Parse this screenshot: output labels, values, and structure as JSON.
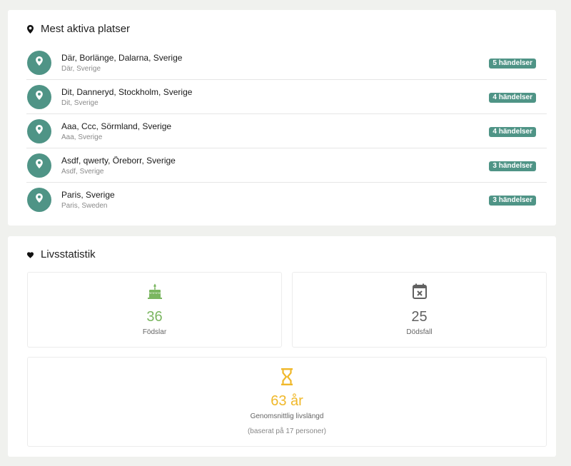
{
  "places": {
    "title": "Mest aktiva platser",
    "items": [
      {
        "name": "Där, Borlänge, Dalarna, Sverige",
        "sub": "Där, Sverige",
        "badge": "5 händelser"
      },
      {
        "name": "Dit, Danneryd, Stockholm, Sverige",
        "sub": "Dit, Sverige",
        "badge": "4 händelser"
      },
      {
        "name": "Aaa, Ccc, Sörmland, Sverige",
        "sub": "Aaa, Sverige",
        "badge": "4 händelser"
      },
      {
        "name": "Asdf, qwerty, Öreborr, Sverige",
        "sub": "Asdf, Sverige",
        "badge": "3 händelser"
      },
      {
        "name": "Paris, Sverige",
        "sub": "Paris, Sweden",
        "badge": "3 händelser"
      }
    ]
  },
  "stats": {
    "title": "Livsstatistik",
    "births": {
      "value": "36",
      "label": "Födslar",
      "icon": "cake-icon"
    },
    "deaths": {
      "value": "25",
      "label": "Dödsfall",
      "icon": "calendar-x-icon"
    },
    "lifespan": {
      "value": "63 år",
      "label": "Genomsnittlig livslängd",
      "note": "(baserat på 17 personer)",
      "icon": "hourglass-icon"
    }
  },
  "colors": {
    "accent": "#4f9486",
    "births": "#7bb661",
    "deaths": "#616161",
    "lifespan": "#f0b82a",
    "background": "#f0f1ee"
  }
}
